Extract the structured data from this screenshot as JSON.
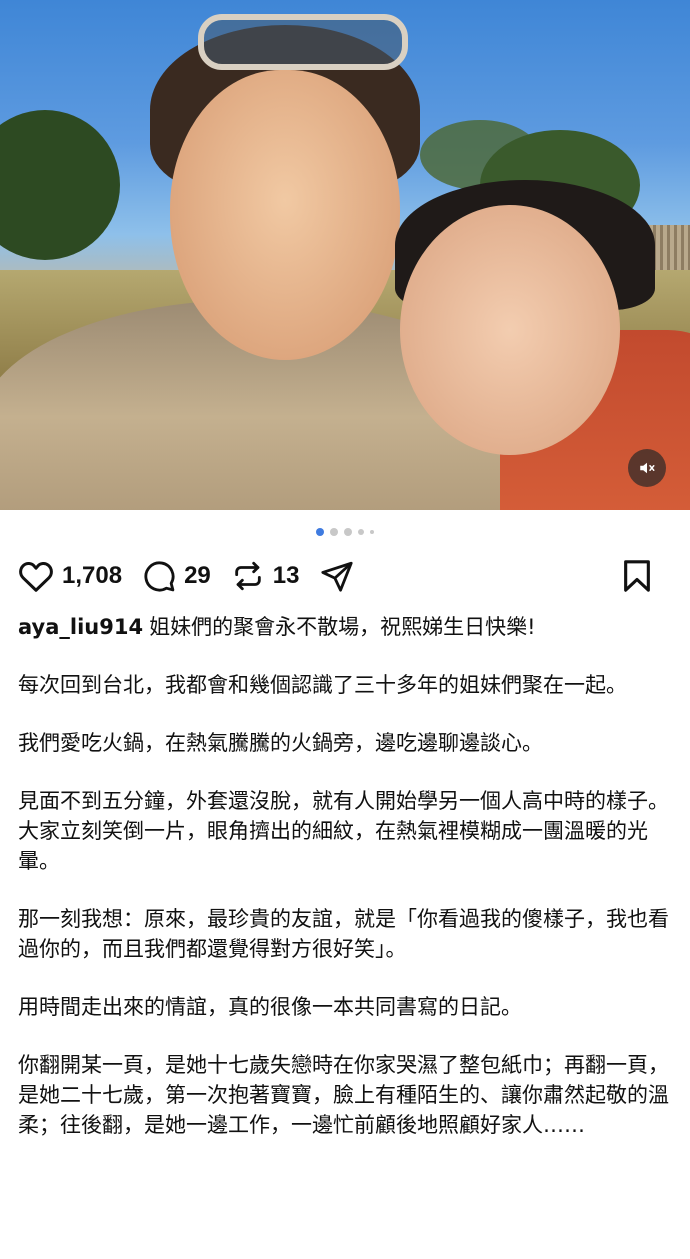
{
  "post": {
    "mute_icon": "speaker-muted-icon",
    "carousel": {
      "count": 5,
      "active_index": 0
    },
    "actions": {
      "likes": "1,708",
      "comments": "29",
      "reposts": "13"
    },
    "username": "aya_liu914",
    "caption_first": "姐妹們的聚會永不散場，祝熙娣生日快樂!",
    "paragraphs": [
      "每次回到台北，我都會和幾個認識了三十多年的姐妹們聚在一起。",
      "我們愛吃火鍋，在熱氣騰騰的火鍋旁，邊吃邊聊邊談心。",
      "見面不到五分鐘，外套還沒脫，就有人開始學另一個人高中時的樣子。大家立刻笑倒一片，眼角擠出的細紋，在熱氣裡模糊成一團溫暖的光暈。",
      "那一刻我想：原來，最珍貴的友誼，就是「你看過我的傻樣子，我也看過你的，而且我們都還覺得對方很好笑」。",
      "用時間走出來的情誼，真的很像一本共同書寫的日記。",
      "你翻開某一頁，是她十七歲失戀時在你家哭濕了整包紙巾；再翻一頁，是她二十七歲，第一次抱著寶寶，臉上有種陌生的、讓你肅然起敬的溫柔；往後翻，是她一邊工作，一邊忙前顧後地照顧好家人……"
    ]
  }
}
